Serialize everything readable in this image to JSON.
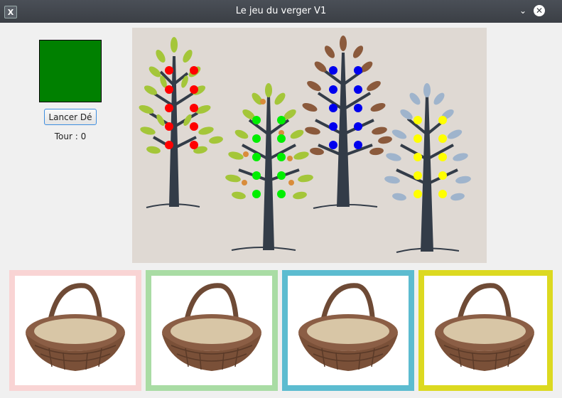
{
  "window": {
    "title": "Le jeu du verger V1",
    "app_icon": "x-window-icon",
    "controls": [
      "chevron-down-icon",
      "close-icon"
    ]
  },
  "dice": {
    "color": "#008000"
  },
  "roll_button": {
    "label": "Lancer Dé"
  },
  "turn": {
    "label": "Tour :",
    "value": "0"
  },
  "orchard": {
    "background": "#dfd9d3",
    "trees": [
      {
        "name": "apple-tree",
        "leaf_color": "#a4c639",
        "fruit_color": "#ff0000",
        "fruit_count": 10
      },
      {
        "name": "pear-tree",
        "leaf_color": "#a4c639",
        "fruit_color": "#00ee00",
        "fruit_count": 10
      },
      {
        "name": "plum-tree",
        "leaf_color": "#8b5a3c",
        "fruit_color": "#0000ee",
        "fruit_count": 10
      },
      {
        "name": "lemon-tree",
        "leaf_color": "#9fb4cc",
        "fruit_color": "#ffff00",
        "fruit_count": 10
      }
    ]
  },
  "baskets": [
    {
      "name": "basket-red",
      "border_color": "#f9d4d4"
    },
    {
      "name": "basket-green",
      "border_color": "#a9dca4"
    },
    {
      "name": "basket-blue",
      "border_color": "#5cbcd0"
    },
    {
      "name": "basket-yellow",
      "border_color": "#dcd920"
    }
  ]
}
